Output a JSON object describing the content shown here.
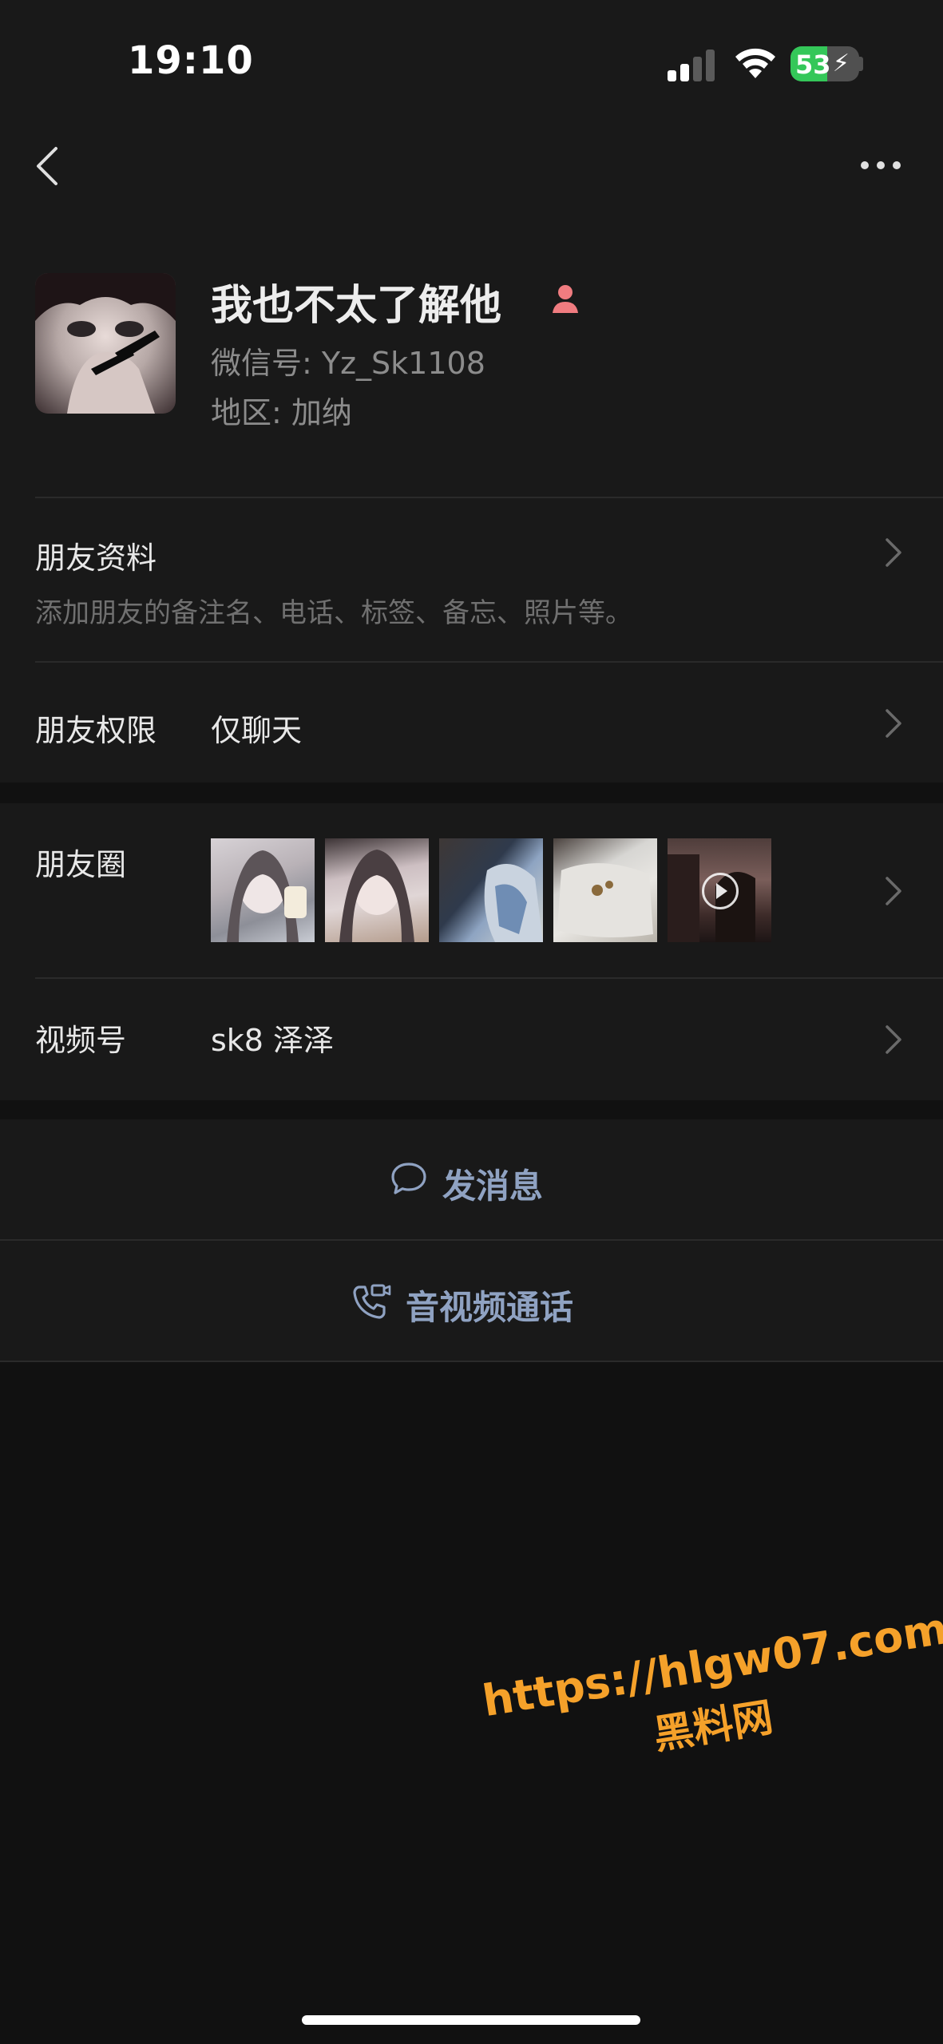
{
  "status_bar": {
    "time": "19:10",
    "battery_level": "53",
    "battery_charging": true,
    "battery_color": "#34c759"
  },
  "nav": {
    "back_icon": "chevron-left-icon",
    "more_icon": "ellipsis-icon"
  },
  "profile": {
    "name": "我也不太了解他",
    "gender_icon": "female-icon",
    "gender_color": "#f07c80",
    "wechat_id": "微信号: Yz_Sk1108",
    "region": "地区: 加纳"
  },
  "rows": {
    "friend_info": {
      "title": "朋友资料",
      "subtitle": "添加朋友的备注名、电话、标签、备忘、照片等。"
    },
    "permission": {
      "title": "朋友权限",
      "value": "仅聊天"
    },
    "moments": {
      "title": "朋友圈",
      "thumbnails": [
        "photo",
        "photo",
        "photo",
        "photo",
        "video"
      ]
    },
    "channels": {
      "title": "视频号",
      "value": "sk8 泽泽"
    }
  },
  "actions": {
    "message": "发消息",
    "call": "音视频通话",
    "accent_color": "#8fa2c2"
  },
  "watermark": {
    "url": "https://hlgw07.com",
    "site": "黑料网"
  }
}
